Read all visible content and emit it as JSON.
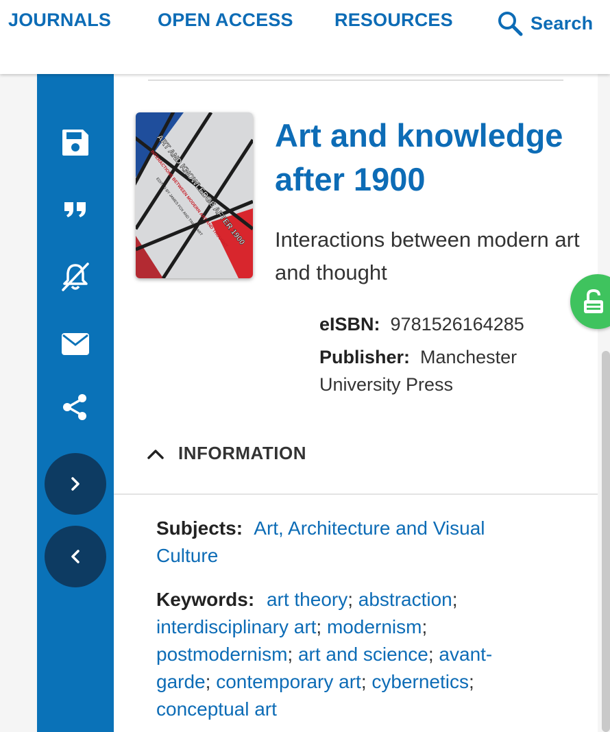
{
  "nav": {
    "journals": "JOURNALS",
    "open_access": "OPEN ACCESS",
    "resources": "RESOURCES",
    "search": "Search"
  },
  "sidebar": {
    "icons": [
      "save-icon",
      "quote-icon",
      "bell-off-icon",
      "email-icon",
      "share-icon"
    ],
    "expand_icon": "chevron-right-icon",
    "collapse_icon": "chevron-left-icon"
  },
  "book": {
    "title": "Art and knowledge after 1900",
    "subtitle": "Interactions between modern art and thought",
    "eisbn_label": "eISBN:",
    "eisbn": "9781526164285",
    "publisher_label": "Publisher:",
    "publisher": "Manchester University Press",
    "cover": {
      "title_text": "ART AND KNOWLEDGE AFTER 1900",
      "subtitle_text": "INTERACTIONS BETWEEN MODERN ART AND THOUGHT",
      "editors_text": "EDITED BY JAMES FOX AND TIM SMART"
    }
  },
  "information": {
    "header": "INFORMATION",
    "subjects_label": "Subjects:",
    "subjects": "Art, Architecture and Visual Culture",
    "keywords_label": "Keywords:",
    "keywords": [
      "art theory",
      "abstraction",
      "interdisciplinary art",
      "modernism",
      "postmodernism",
      "art and science",
      "avant-garde",
      "contemporary art",
      "cybernetics",
      "conceptual art"
    ]
  },
  "colors": {
    "brand_blue": "#0d6cb6",
    "sidebar_blue": "#0a72b8",
    "dark_navy": "#0d3b62",
    "open_access_green": "#3fc35e"
  }
}
